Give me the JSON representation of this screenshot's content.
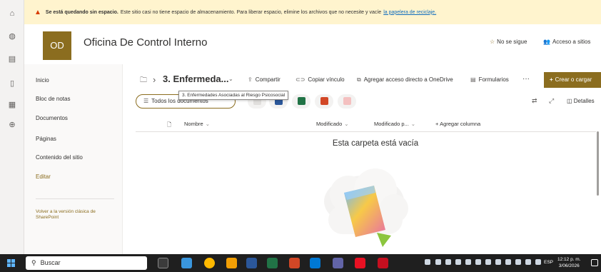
{
  "warning": {
    "bold": "Se está quedando sin espacio.",
    "text": "Este sitio casi no tiene espacio de almacenamiento. Para liberar espacio, elimine los archivos que no necesite y vacíe",
    "link": "la papelera de reciclaje."
  },
  "site": {
    "logo": "OD",
    "title": "Oficina De Control Interno",
    "follow": "No se sigue",
    "access": "Acceso a sitios"
  },
  "nav": {
    "items": [
      "Inicio",
      "Bloc de notas",
      "Documentos",
      "Páginas",
      "Contenido del sitio"
    ],
    "edit": "Editar",
    "classic": "Volver a la versión clásica de SharePoint"
  },
  "toolbar": {
    "crumb_sep": "›",
    "folder": "3. Enfermeda...",
    "share": "Compartir",
    "copy_link": "Copiar vínculo",
    "shortcut": "Agregar acceso directo a OneDrive",
    "forms": "Formularios",
    "more": "···",
    "create": "Crear o cargar"
  },
  "tooltip": "3. Enfermedades Asociadas al Riesgo Psicosocial",
  "view": {
    "label": "Todos los documentos"
  },
  "details": "Detalles",
  "columns": {
    "name": "Nombre",
    "modified": "Modificado",
    "modified_by": "Modificado p...",
    "add": "Agregar columna"
  },
  "empty": {
    "title": "Esta carpeta está vacía"
  },
  "taskbar": {
    "search": "Buscar",
    "lang": "ESP",
    "time": "12:12 p. m.",
    "date": "3/06/2026"
  },
  "colors": {
    "accent": "#8b6d1f",
    "warning_bg": "#fff4ce",
    "link": "#0f6cbd",
    "taskbar": "#1f1f1f"
  }
}
